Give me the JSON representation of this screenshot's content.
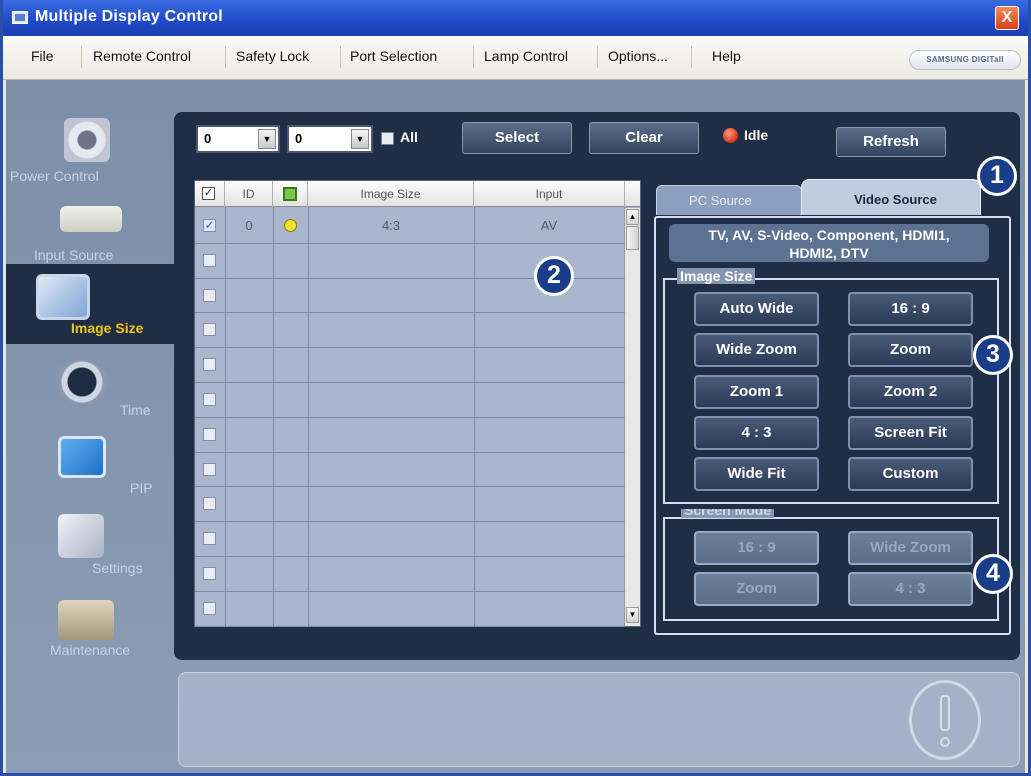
{
  "window": {
    "title": "Multiple Display Control",
    "close_label": "X"
  },
  "menu": {
    "items": [
      "File",
      "Remote Control",
      "Safety Lock",
      "Port Selection",
      "Lamp Control",
      "Options...",
      "Help"
    ],
    "brand": "SAMSUNG DIGITall"
  },
  "sidebar": {
    "items": [
      {
        "label": "Power Control",
        "icon": "power-icon"
      },
      {
        "label": "Input Source",
        "icon": "input-source-icon"
      },
      {
        "label": "Image Size",
        "icon": "image-size-icon",
        "active": true
      },
      {
        "label": "Time",
        "icon": "clock-icon"
      },
      {
        "label": "PIP",
        "icon": "pip-icon"
      },
      {
        "label": "Settings",
        "icon": "settings-icon"
      },
      {
        "label": "Maintenance",
        "icon": "maintenance-icon"
      }
    ]
  },
  "toolbar": {
    "combo1_value": "0",
    "combo2_value": "0",
    "all_label": "All",
    "select_label": "Select",
    "clear_label": "Clear",
    "status": "Idle",
    "status_color": "#e0402a",
    "refresh_label": "Refresh"
  },
  "grid": {
    "columns": [
      "",
      "ID",
      "",
      "Image Size",
      "Input"
    ],
    "rows": [
      {
        "checked": true,
        "id": "0",
        "status_color": "#f0e030",
        "image_size": "4:3",
        "input": "AV"
      }
    ],
    "empty_rows": 11
  },
  "tabs": {
    "pc_label": "PC Source",
    "video_label": "Video Source",
    "active": "Video Source"
  },
  "source_info": {
    "text_line1": "TV, AV, S-Video, Component, HDMI1,",
    "text_line2": "HDMI2, DTV"
  },
  "image_size": {
    "title": "Image Size",
    "buttons": [
      "Auto Wide",
      "16 : 9",
      "Wide Zoom",
      "Zoom",
      "Zoom 1",
      "Zoom 2",
      "4 : 3",
      "Screen Fit",
      "Wide Fit",
      "Custom"
    ]
  },
  "screen_mode": {
    "title": "Screen Mode",
    "buttons": [
      "16 : 9",
      "Wide Zoom",
      "Zoom",
      "4 : 3"
    ]
  },
  "callouts": [
    "1",
    "2",
    "3",
    "4"
  ],
  "colors": {
    "accent": "#f2c51c",
    "panel": "#1f2e44",
    "titlebar": "#1f4ac7"
  }
}
